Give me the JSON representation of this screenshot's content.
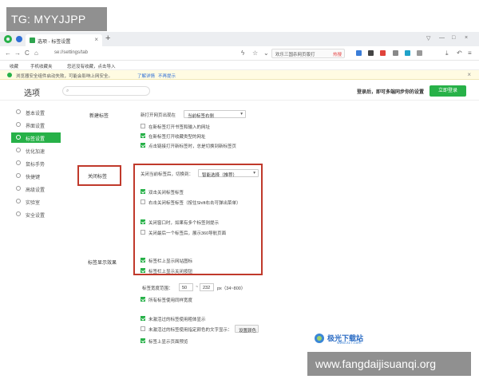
{
  "overlay": {
    "tg": "TG: MYYJJPP",
    "site": "www.fangdaijisuanqi.org"
  },
  "browser": {
    "tab_title": "选项 - 标签设置",
    "tab_close": "×",
    "new_tab": "+",
    "url": "se://settings/tab",
    "search_query": "欢乐三国杀网页版打",
    "search_hot": "热搜",
    "bookmarks": [
      "收藏",
      "手机收藏夹",
      "您还没有收藏，点击导入"
    ],
    "infobar": {
      "text": "浏览器安全组件启动失败，可能会影响上网安全。",
      "link1": "了解详情",
      "link2": "不再提示",
      "close": "×"
    },
    "nav": {
      "back": "←",
      "forward": "→",
      "reload": "C",
      "home": "⌂"
    },
    "window_controls": [
      "▽",
      "—",
      "□",
      "×"
    ]
  },
  "page": {
    "title": "选项",
    "login_hint": "登录后，即可多端同步你的设置",
    "login_button": "立即登录"
  },
  "sidebar": {
    "items": [
      {
        "label": "基本设置",
        "icon": "gear-icon"
      },
      {
        "label": "界面设置",
        "icon": "layout-icon"
      },
      {
        "label": "标签设置",
        "icon": "tab-icon",
        "active": true
      },
      {
        "label": "优化加速",
        "icon": "rocket-icon"
      },
      {
        "label": "鼠标手势",
        "icon": "mouse-icon"
      },
      {
        "label": "快捷键",
        "icon": "keyboard-icon"
      },
      {
        "label": "高级设置",
        "icon": "advanced-icon"
      },
      {
        "label": "实验室",
        "icon": "flask-icon"
      },
      {
        "label": "安全设置",
        "icon": "shield-icon"
      }
    ]
  },
  "new_tab": {
    "section": "新建标签",
    "open_pos_label": "新打开网页出现在",
    "open_pos_value": "当前标签右侧",
    "opts": [
      {
        "label": "在新标签打开书签和输入的网址",
        "checked": false
      },
      {
        "label": "在新标签打开收藏类型的网址",
        "checked": true
      },
      {
        "label": "点击链接打开新标签时，总是切换到新标签页",
        "checked": true
      }
    ]
  },
  "close_tab": {
    "section": "关闭标签",
    "switch_label": "关闭当前标签后，切换到：",
    "switch_value": "智能选择（推荐）",
    "opts": [
      {
        "label": "双击关闭标签标签",
        "checked": true
      },
      {
        "label": "右击关闭标签标签（按住Shift右击可弹出菜单）",
        "checked": false
      },
      {
        "label": "关闭窗口时，如果有多个标签则提示",
        "checked": true
      },
      {
        "label": "关闭最后一个标签后，展示360导航页面",
        "checked": false
      }
    ]
  },
  "tab_display": {
    "section": "标签显示效果",
    "opts_top": [
      {
        "label": "标签栏上显示网站图标",
        "checked": true
      },
      {
        "label": "标签栏上显示关闭按钮",
        "checked": true
      }
    ],
    "width_label": "标签宽度范围：",
    "width_min": "50",
    "width_sep": "~",
    "width_max": "232",
    "width_unit": "px（34~800）",
    "opt_same_width": {
      "label": "所有标签使用同样宽度",
      "checked": true
    },
    "opts_bottom": [
      {
        "label": "未激活过的标签使用粗体显示",
        "checked": true
      },
      {
        "label": "未激活过的标签使用指定颜色的文字显示：",
        "checked": false
      },
      {
        "label": "标签上显示页面预览",
        "checked": true
      }
    ],
    "color_button": "设置颜色"
  },
  "watermark": {
    "name": "极光下载站",
    "url": "www.xz7.com"
  },
  "colors": {
    "accent": "#27b148",
    "highlight": "#c0392b"
  }
}
